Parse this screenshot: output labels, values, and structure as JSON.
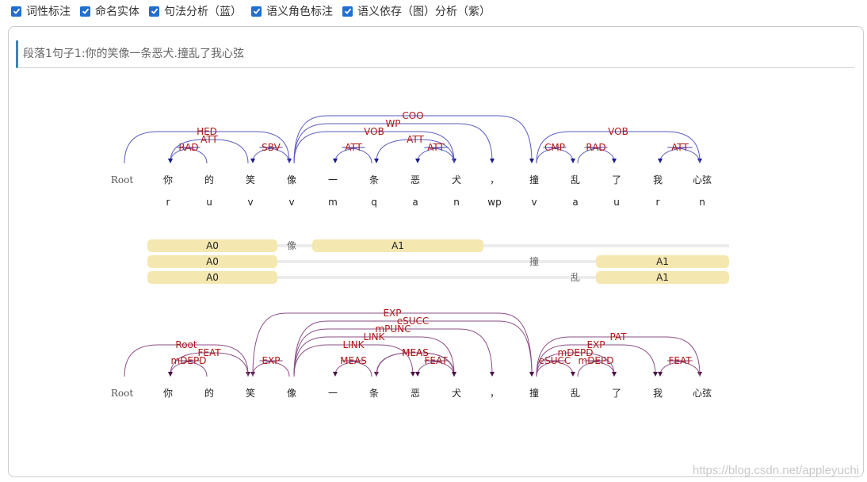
{
  "toolbar": {
    "options": [
      {
        "label": "词性标注",
        "checked": true
      },
      {
        "label": "命名实体",
        "checked": true
      },
      {
        "label": "句法分析（蓝）",
        "checked": true
      },
      {
        "label": "语义角色标注",
        "checked": true
      },
      {
        "label": "语义依存（图）分析（紫）",
        "checked": true
      }
    ]
  },
  "sentence": {
    "title": "段落1句子1:你的笑像一条恶犬.撞乱了我心弦"
  },
  "root_label": "Root",
  "tokens": [
    "你",
    "的",
    "笑",
    "像",
    "一",
    "条",
    "恶",
    "犬",
    "，",
    "撞",
    "乱",
    "了",
    "我",
    "心弦"
  ],
  "pos_tags": [
    "r",
    "u",
    "v",
    "v",
    "m",
    "q",
    "a",
    "n",
    "wp",
    "v",
    "a",
    "u",
    "r",
    "n"
  ],
  "syntax_arcs": [
    {
      "from": 0,
      "to": 4,
      "label": "HED"
    },
    {
      "from": 2,
      "to": 1,
      "label": "RAD"
    },
    {
      "from": 3,
      "to": 1,
      "label": "ATT"
    },
    {
      "from": 4,
      "to": 3,
      "label": "SBV"
    },
    {
      "from": 4,
      "to": 10,
      "label": "COO"
    },
    {
      "from": 4,
      "to": 9,
      "label": "WP"
    },
    {
      "from": 4,
      "to": 8,
      "label": "VOB"
    },
    {
      "from": 6,
      "to": 5,
      "label": "ATT"
    },
    {
      "from": 8,
      "to": 6,
      "label": "ATT"
    },
    {
      "from": 8,
      "to": 7,
      "label": "ATT"
    },
    {
      "from": 10,
      "to": 11,
      "label": "CMP"
    },
    {
      "from": 11,
      "to": 12,
      "label": "RAD"
    },
    {
      "from": 10,
      "to": 14,
      "label": "VOB"
    },
    {
      "from": 14,
      "to": 13,
      "label": "ATT"
    }
  ],
  "semantic_roles": [
    {
      "predicate": "像",
      "predicate_index": 4,
      "args": [
        {
          "label": "A0",
          "from": 1,
          "to": 3
        },
        {
          "label": "A1",
          "from": 5,
          "to": 8
        }
      ]
    },
    {
      "predicate": "撞",
      "predicate_index": 10,
      "args": [
        {
          "label": "A0",
          "from": 1,
          "to": 3
        },
        {
          "label": "A1",
          "from": 12,
          "to": 14
        }
      ]
    },
    {
      "predicate": "乱",
      "predicate_index": 11,
      "args": [
        {
          "label": "A0",
          "from": 1,
          "to": 3
        },
        {
          "label": "A1",
          "from": 12,
          "to": 14
        }
      ]
    }
  ],
  "semdep_arcs": [
    {
      "from": 0,
      "to": 3,
      "label": "Root"
    },
    {
      "from": 3,
      "to": 1,
      "label": "FEAT"
    },
    {
      "from": 2,
      "to": 1,
      "label": "mDEPD"
    },
    {
      "from": 4,
      "to": 3,
      "label": "EXP"
    },
    {
      "from": 3,
      "to": 10,
      "label": "EXP"
    },
    {
      "from": 4,
      "to": 10,
      "label": "eSUCC"
    },
    {
      "from": 4,
      "to": 9,
      "label": "mPUNC"
    },
    {
      "from": 4,
      "to": 8,
      "label": "LINK"
    },
    {
      "from": 4,
      "to": 7,
      "label": "LINK"
    },
    {
      "from": 6,
      "to": 5,
      "label": "MEAS"
    },
    {
      "from": 8,
      "to": 6,
      "label": "MEAS"
    },
    {
      "from": 8,
      "to": 7,
      "label": "FEAT"
    },
    {
      "from": 6,
      "to": 8,
      "label": "MEAS"
    },
    {
      "from": 10,
      "to": 14,
      "label": "PAT"
    },
    {
      "from": 10,
      "to": 13,
      "label": "EXP"
    },
    {
      "from": 10,
      "to": 11,
      "label": "eSUCC"
    },
    {
      "from": 11,
      "to": 12,
      "label": "mDEPD"
    },
    {
      "from": 10,
      "to": 12,
      "label": "mDEPD"
    },
    {
      "from": 14,
      "to": 13,
      "label": "FEAT"
    }
  ],
  "watermark": "https://blog.csdn.net/appleyuchi",
  "colors": {
    "checkbox": "#1e6fd0",
    "syntax_arc": "#5a5ac0",
    "syntax_arrow": "#1a1a8c",
    "semdep_arc": "#8a4f84",
    "semdep_arrow": "#4a1346",
    "arc_label": "#b01818",
    "role_bar": "#f5e7b0",
    "role_line": "#ececec",
    "accent": "#3b86b5"
  }
}
